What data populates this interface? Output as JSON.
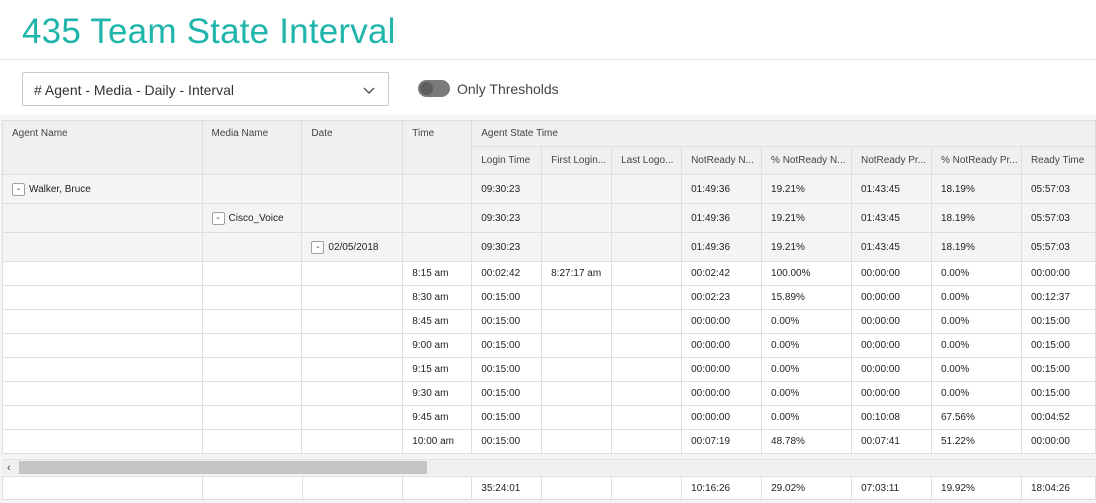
{
  "page": {
    "title": "435 Team State Interval"
  },
  "filter": {
    "selected": "# Agent - Media - Daily - Interval",
    "chevron_icon": "chevron-down-icon"
  },
  "toggle": {
    "label": "Only Thresholds",
    "state": "off"
  },
  "grid": {
    "headers": {
      "agent_name": "Agent Name",
      "media_name": "Media Name",
      "date": "Date",
      "time": "Time",
      "group": "Agent State Time",
      "sub": [
        "Login Time",
        "First Login...",
        "Last Logo...",
        "NotReady N...",
        "% NotReady N...",
        "NotReady Pr...",
        "% NotReady Pr...",
        "Ready Time"
      ]
    },
    "agent_row": {
      "label": "Walker, Bruce",
      "values": [
        "09:30:23",
        "",
        "",
        "01:49:36",
        "19.21%",
        "01:43:45",
        "18.19%",
        "05:57:03"
      ]
    },
    "media_row": {
      "label": "Cisco_Voice",
      "values": [
        "09:30:23",
        "",
        "",
        "01:49:36",
        "19.21%",
        "01:43:45",
        "18.19%",
        "05:57:03"
      ]
    },
    "date_row": {
      "label": "02/05/2018",
      "values": [
        "09:30:23",
        "",
        "",
        "01:49:36",
        "19.21%",
        "01:43:45",
        "18.19%",
        "05:57:03"
      ]
    },
    "rows": [
      {
        "time": "8:15 am",
        "values": [
          "00:02:42",
          "8:27:17 am",
          "",
          "00:02:42",
          "100.00%",
          "00:00:00",
          "0.00%",
          "00:00:00"
        ]
      },
      {
        "time": "8:30 am",
        "values": [
          "00:15:00",
          "",
          "",
          "00:02:23",
          "15.89%",
          "00:00:00",
          "0.00%",
          "00:12:37"
        ]
      },
      {
        "time": "8:45 am",
        "values": [
          "00:15:00",
          "",
          "",
          "00:00:00",
          "0.00%",
          "00:00:00",
          "0.00%",
          "00:15:00"
        ]
      },
      {
        "time": "9:00 am",
        "values": [
          "00:15:00",
          "",
          "",
          "00:00:00",
          "0.00%",
          "00:00:00",
          "0.00%",
          "00:15:00"
        ]
      },
      {
        "time": "9:15 am",
        "values": [
          "00:15:00",
          "",
          "",
          "00:00:00",
          "0.00%",
          "00:00:00",
          "0.00%",
          "00:15:00"
        ]
      },
      {
        "time": "9:30 am",
        "values": [
          "00:15:00",
          "",
          "",
          "00:00:00",
          "0.00%",
          "00:00:00",
          "0.00%",
          "00:15:00"
        ]
      },
      {
        "time": "9:45 am",
        "values": [
          "00:15:00",
          "",
          "",
          "00:00:00",
          "0.00%",
          "00:10:08",
          "67.56%",
          "00:04:52"
        ]
      },
      {
        "time": "10:00 am",
        "values": [
          "00:15:00",
          "",
          "",
          "00:07:19",
          "48.78%",
          "00:07:41",
          "51.22%",
          "00:00:00"
        ]
      }
    ],
    "totals": [
      "35:24:01",
      "",
      "",
      "10:16:26",
      "29.02%",
      "07:03:11",
      "19.92%",
      "18:04:26"
    ]
  },
  "scrollbar": {
    "left_arrow": "‹"
  }
}
